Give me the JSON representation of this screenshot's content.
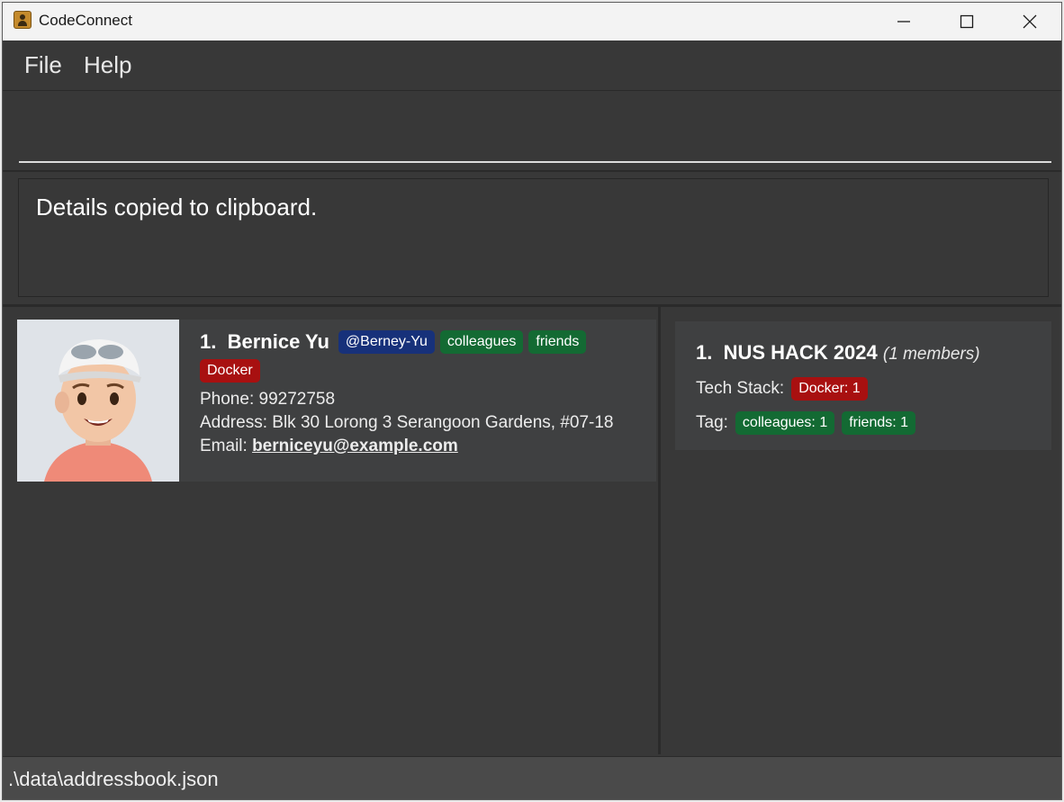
{
  "window": {
    "title": "CodeConnect"
  },
  "menu": {
    "file": "File",
    "help": "Help"
  },
  "command": {
    "value": ""
  },
  "result": {
    "message": "Details copied to clipboard."
  },
  "persons": [
    {
      "index": "1.",
      "name": "Bernice Yu",
      "github": "@Berney-Yu",
      "tags": [
        "colleagues",
        "friends"
      ],
      "tech": [
        "Docker"
      ],
      "phone_label": "Phone:",
      "phone": "99272758",
      "address_label": "Address:",
      "address": "Blk 30 Lorong 3 Serangoon Gardens, #07-18",
      "email_label": "Email:",
      "email": "berniceyu@example.com"
    }
  ],
  "groups": [
    {
      "index": "1.",
      "name": "NUS HACK 2024",
      "members": "(1 members)",
      "tech_label": "Tech Stack:",
      "tech": [
        "Docker: 1"
      ],
      "tag_label": "Tag:",
      "tags": [
        "colleagues: 1",
        "friends: 1"
      ]
    }
  ],
  "status": {
    "path": ".\\data\\addressbook.json"
  },
  "colors": {
    "background": "#383838",
    "card": "#3f4041",
    "github_badge": "#17317a",
    "tag_badge": "#136a33",
    "tech_badge": "#a81010",
    "status_bar": "#4a4a4a"
  }
}
